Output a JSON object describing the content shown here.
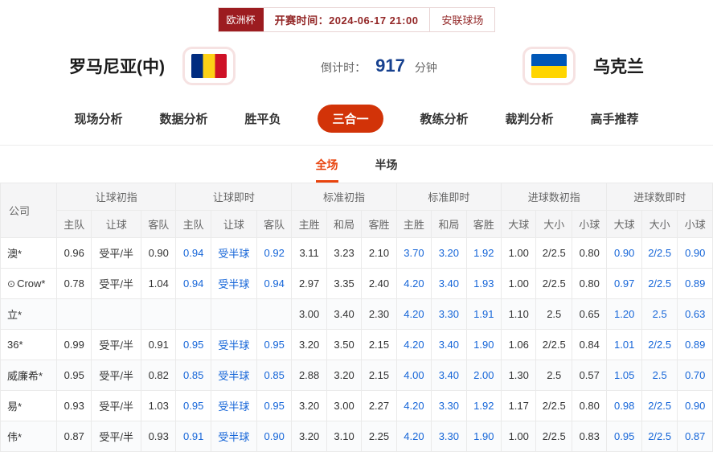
{
  "header": {
    "league_badge": "欧洲杯",
    "kickoff_label": "开赛时间：2024-06-17 21:00",
    "venue": "安联球场"
  },
  "teams": {
    "home": {
      "name": "罗马尼亚(中)",
      "flag": "romania"
    },
    "away": {
      "name": "乌克兰",
      "flag": "ukraine"
    }
  },
  "countdown": {
    "label": "倒计时：",
    "value": "917",
    "unit": "分钟"
  },
  "nav": {
    "items": [
      {
        "label": "现场分析",
        "active": false
      },
      {
        "label": "数据分析",
        "active": false
      },
      {
        "label": "胜平负",
        "active": false
      },
      {
        "label": "三合一",
        "active": true
      },
      {
        "label": "教练分析",
        "active": false
      },
      {
        "label": "裁判分析",
        "active": false
      },
      {
        "label": "高手推荐",
        "active": false
      }
    ]
  },
  "subtabs": [
    {
      "label": "全场",
      "active": true
    },
    {
      "label": "半场",
      "active": false
    }
  ],
  "table": {
    "company_header": "公司",
    "company_icon_glyph": "⊙",
    "groups": [
      {
        "label": "让球初指",
        "cols": [
          "主队",
          "让球",
          "客队"
        ],
        "style": "initial"
      },
      {
        "label": "让球即时",
        "cols": [
          "主队",
          "让球",
          "客队"
        ],
        "style": "live"
      },
      {
        "label": "标准初指",
        "cols": [
          "主胜",
          "和局",
          "客胜"
        ],
        "style": "initial"
      },
      {
        "label": "标准即时",
        "cols": [
          "主胜",
          "和局",
          "客胜"
        ],
        "style": "live"
      },
      {
        "label": "进球数初指",
        "cols": [
          "大球",
          "大小",
          "小球"
        ],
        "style": "initial"
      },
      {
        "label": "进球数即时",
        "cols": [
          "大球",
          "大小",
          "小球"
        ],
        "style": "live"
      }
    ],
    "rows": [
      {
        "company": "澳*",
        "has_icon": false,
        "cells": [
          "0.96",
          "受平/半",
          "0.90",
          "0.94",
          "受半球",
          "0.92",
          "3.11",
          "3.23",
          "2.10",
          "3.70",
          "3.20",
          "1.92",
          "1.00",
          "2/2.5",
          "0.80",
          "0.90",
          "2/2.5",
          "0.90"
        ]
      },
      {
        "company": "Crow*",
        "has_icon": true,
        "cells": [
          "0.78",
          "受平/半",
          "1.04",
          "0.94",
          "受半球",
          "0.94",
          "2.97",
          "3.35",
          "2.40",
          "4.20",
          "3.40",
          "1.93",
          "1.00",
          "2/2.5",
          "0.80",
          "0.97",
          "2/2.5",
          "0.89"
        ]
      },
      {
        "company": "立*",
        "has_icon": false,
        "cells": [
          "",
          "",
          "",
          "",
          "",
          "",
          "3.00",
          "3.40",
          "2.30",
          "4.20",
          "3.30",
          "1.91",
          "1.10",
          "2.5",
          "0.65",
          "1.20",
          "2.5",
          "0.63"
        ]
      },
      {
        "company": "36*",
        "has_icon": false,
        "cells": [
          "0.99",
          "受平/半",
          "0.91",
          "0.95",
          "受半球",
          "0.95",
          "3.20",
          "3.50",
          "2.15",
          "4.20",
          "3.40",
          "1.90",
          "1.06",
          "2/2.5",
          "0.84",
          "1.01",
          "2/2.5",
          "0.89"
        ]
      },
      {
        "company": "威廉希*",
        "has_icon": false,
        "cells": [
          "0.95",
          "受平/半",
          "0.82",
          "0.85",
          "受半球",
          "0.85",
          "2.88",
          "3.20",
          "2.15",
          "4.00",
          "3.40",
          "2.00",
          "1.30",
          "2.5",
          "0.57",
          "1.05",
          "2.5",
          "0.70"
        ]
      },
      {
        "company": "易*",
        "has_icon": false,
        "cells": [
          "0.93",
          "受平/半",
          "1.03",
          "0.95",
          "受半球",
          "0.95",
          "3.20",
          "3.00",
          "2.27",
          "4.20",
          "3.30",
          "1.92",
          "1.17",
          "2/2.5",
          "0.80",
          "0.98",
          "2/2.5",
          "0.90"
        ]
      },
      {
        "company": "伟*",
        "has_icon": false,
        "cells": [
          "0.87",
          "受平/半",
          "0.93",
          "0.91",
          "受半球",
          "0.90",
          "3.20",
          "3.10",
          "2.25",
          "4.20",
          "3.30",
          "1.90",
          "1.00",
          "2/2.5",
          "0.83",
          "0.95",
          "2/2.5",
          "0.87"
        ]
      }
    ]
  },
  "colors": {
    "accent_red": "#d23308",
    "subtab_red": "#e8430d",
    "live_blue": "#1565d8",
    "countdown_navy": "#17418f",
    "badge_maroon": "#9c1c20",
    "kickoff_text": "#932727"
  }
}
